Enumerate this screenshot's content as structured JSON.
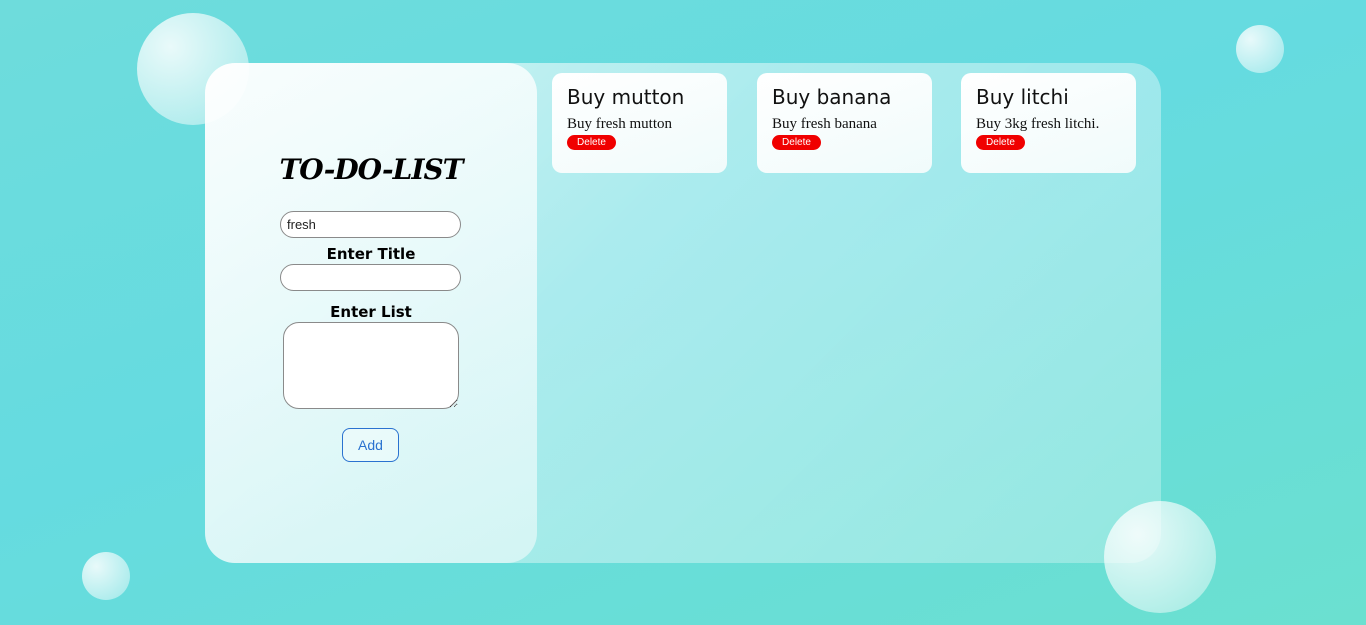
{
  "app": {
    "title": "TO-DO-LIST"
  },
  "form": {
    "search_value": "fresh",
    "title_label": "Enter Title",
    "title_value": "",
    "list_label": "Enter List",
    "list_value": "",
    "add_label": "Add"
  },
  "cards": [
    {
      "title": "Buy mutton",
      "text": "Buy fresh mutton",
      "delete_label": "Delete"
    },
    {
      "title": "Buy banana",
      "text": "Buy fresh banana",
      "delete_label": "Delete"
    },
    {
      "title": "Buy litchi",
      "text": "Buy 3kg fresh litchi.",
      "delete_label": "Delete"
    }
  ],
  "colors": {
    "delete": "#f00000",
    "add_button": "#2a72d0",
    "background": "#65dbe0"
  }
}
